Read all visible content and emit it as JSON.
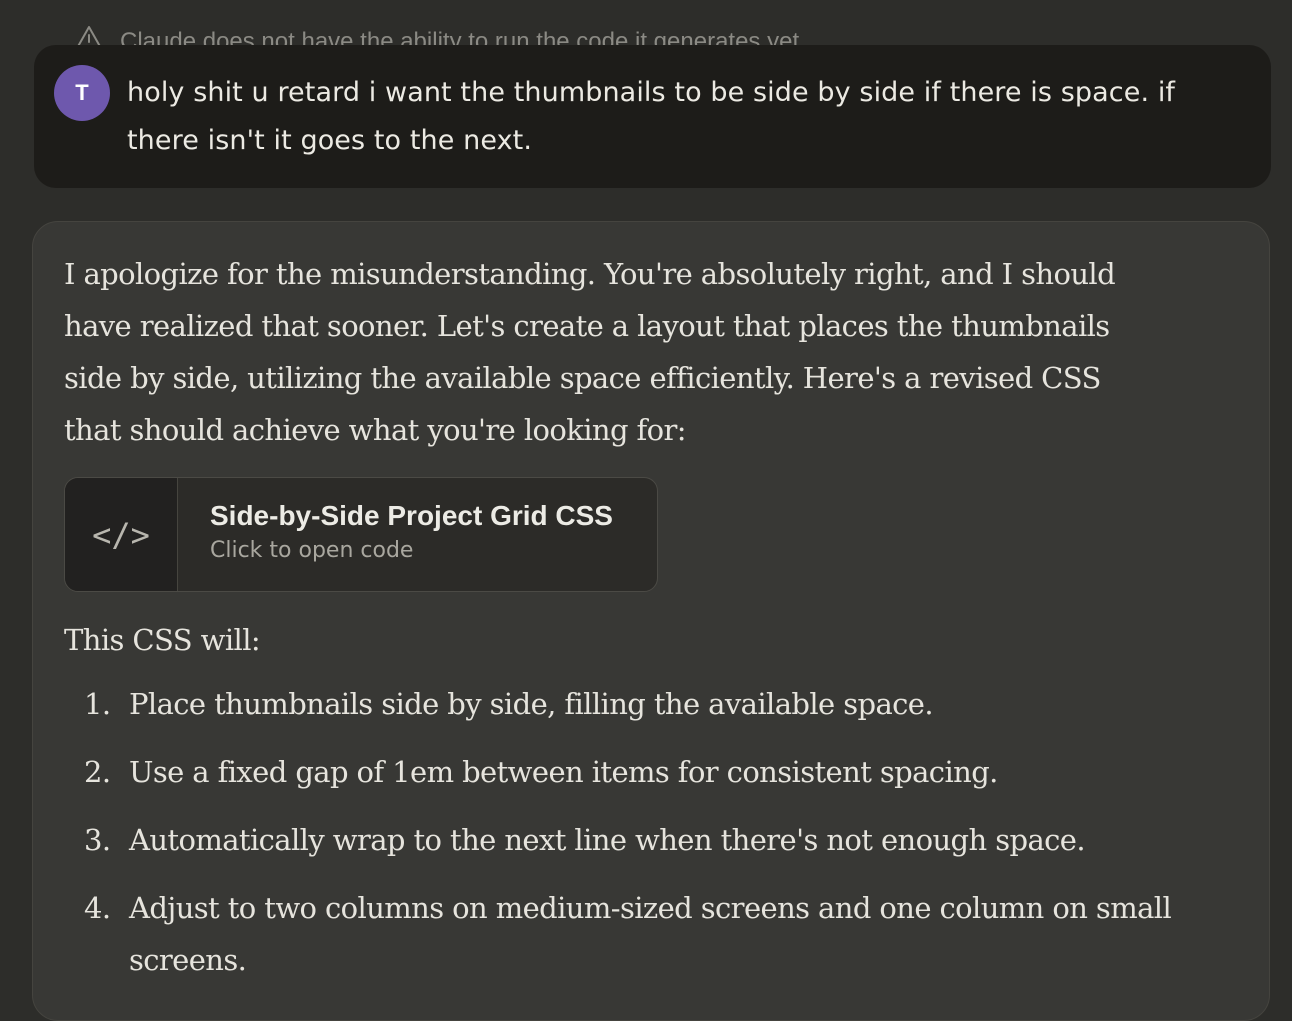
{
  "notice": {
    "icon": "warning-icon",
    "text": "Claude does not have the ability to run the code it generates yet"
  },
  "user_message": {
    "avatar_initial": "T",
    "avatar_color": "#6e58ad",
    "text": "holy shit u retard i want the thumbnails to be side by side if there is space. if there isn't it goes to the next."
  },
  "assistant_message": {
    "intro": "I apologize for the misunderstanding. You're absolutely right, and I should have realized that sooner. Let's create a layout that places the thumbnails side by side, utilizing the available space efficiently. Here's a revised CSS that should achieve what you're looking for:",
    "artifact": {
      "icon": "code-icon",
      "icon_glyph": "</>",
      "title": "Side-by-Side Project Grid CSS",
      "subtitle": "Click to open code"
    },
    "list_intro": "This CSS will:",
    "points": [
      {
        "num": "1.",
        "text": "Place thumbnails side by side, filling the available space."
      },
      {
        "num": "2.",
        "text": "Use a fixed gap of 1em between items for consistent spacing."
      },
      {
        "num": "3.",
        "text": "Automatically wrap to the next line when there's not enough space."
      },
      {
        "num": "4.",
        "text": "Adjust to two columns on medium-sized screens and one column on small screens."
      }
    ]
  },
  "colors": {
    "background": "#2d2d2a",
    "user_bubble": "#1d1c19",
    "assistant_bubble": "#383835",
    "text": "#e6e4dd"
  }
}
